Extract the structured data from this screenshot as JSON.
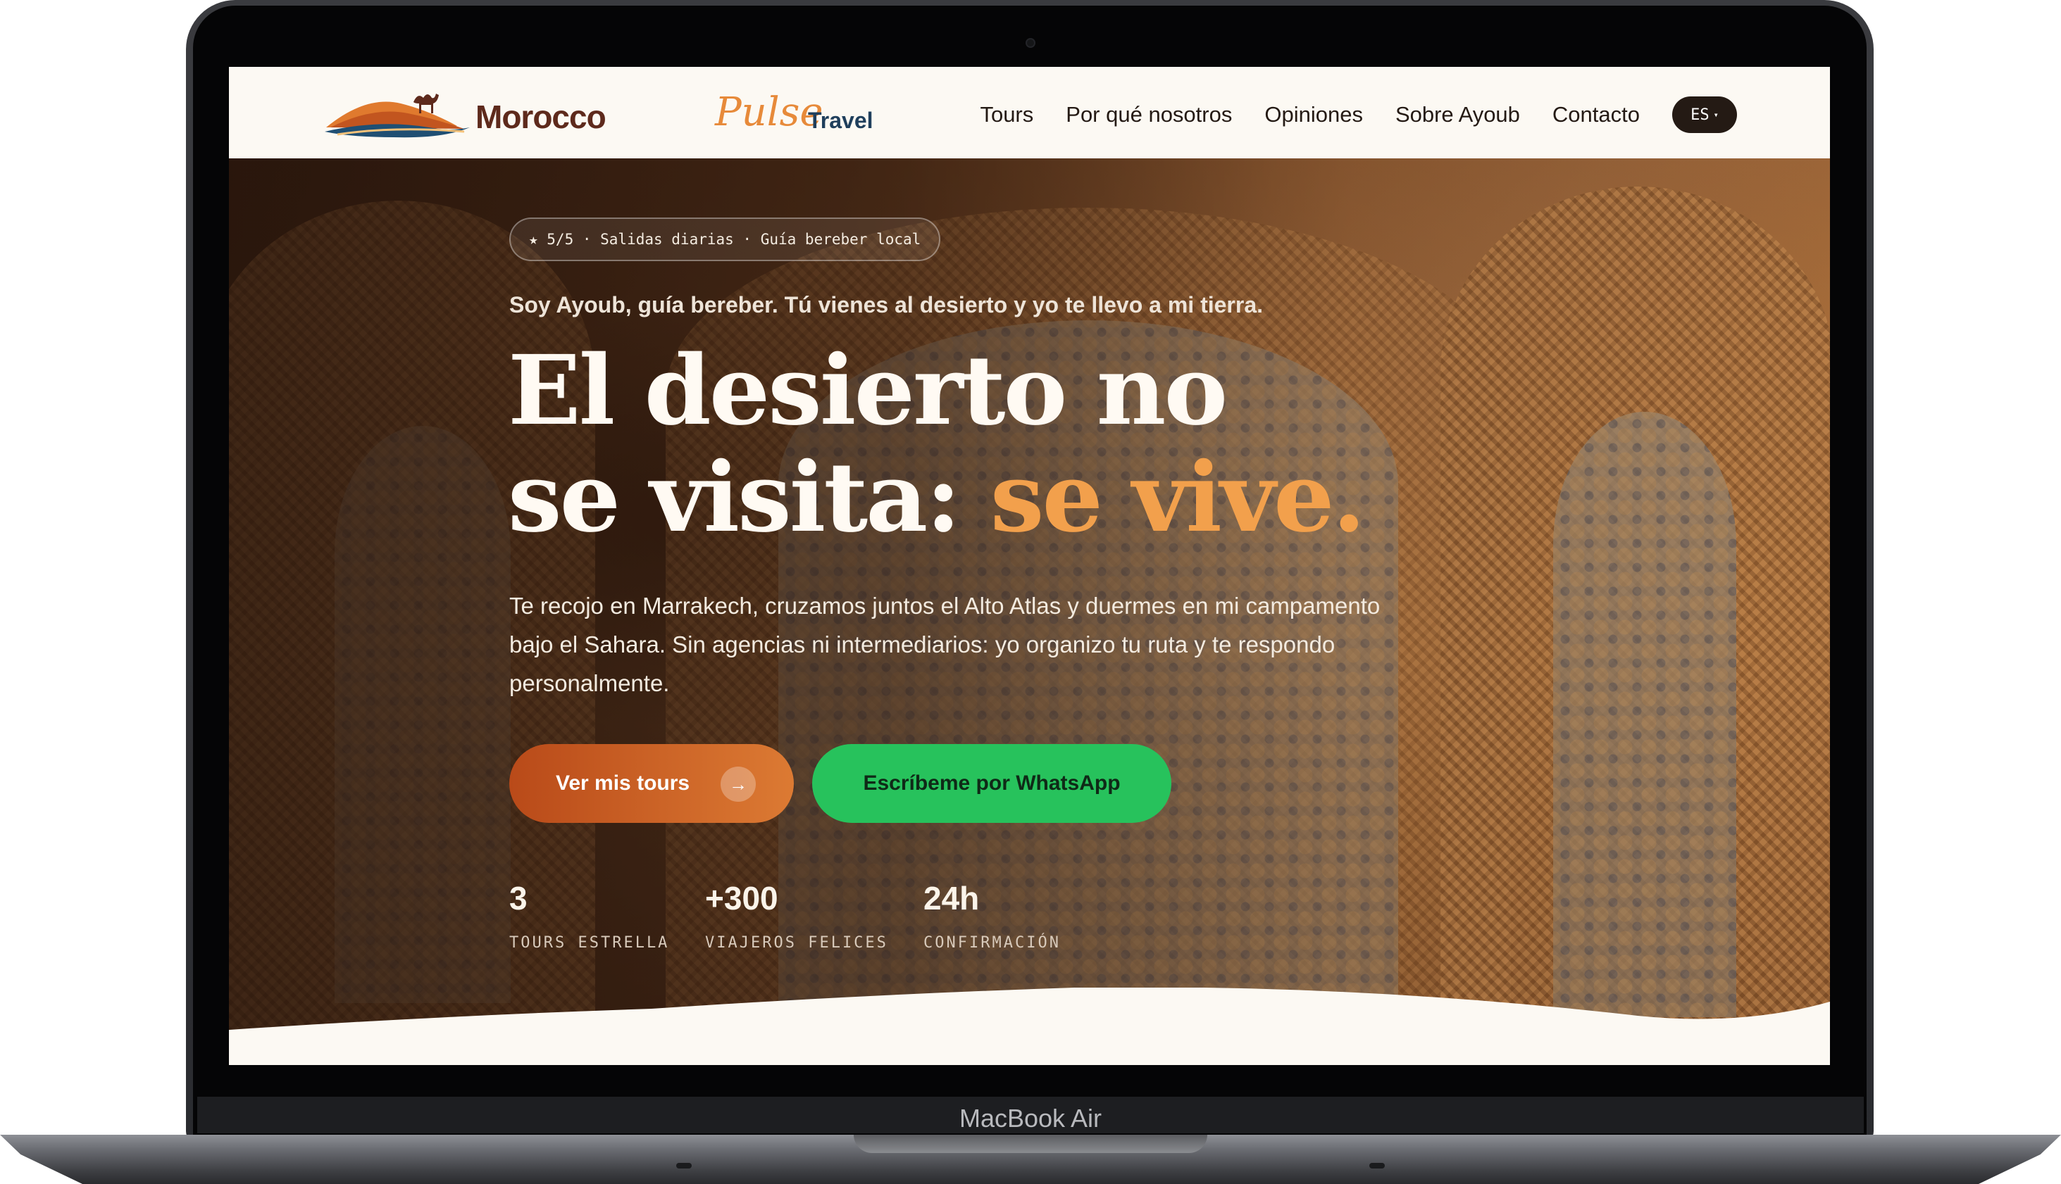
{
  "device": {
    "label": "MacBook Air"
  },
  "nav": {
    "brand": {
      "word1": "Morocco",
      "word2": "Pulse",
      "word3": "Travel"
    },
    "items": [
      {
        "label": "Tours"
      },
      {
        "label": "Por qué nosotros"
      },
      {
        "label": "Opiniones"
      },
      {
        "label": "Sobre Ayoub"
      },
      {
        "label": "Contacto"
      }
    ],
    "language": "ES",
    "language_caret": "▾"
  },
  "hero": {
    "badge": "★ 5/5 · Salidas diarias · Guía bereber local",
    "kicker": "Soy Ayoub, guía bereber. Tú vienes al desierto y yo te llevo a mi tierra.",
    "title_line1": "El desierto no",
    "title_line2_a": "se visita: ",
    "title_line2_b": "se vive.",
    "lead": "Te recojo en Marrakech, cruzamos juntos el Alto Atlas y duermes en mi campamento bajo el Sahara. Sin agencias ni intermediarios: yo organizo tu ruta y te respondo personalmente.",
    "cta_primary": "Ver mis tours",
    "cta_primary_icon": "→",
    "cta_secondary": "Escríbeme por WhatsApp",
    "stats": [
      {
        "value": "3",
        "label": "TOURS ESTRELLA"
      },
      {
        "value": "+300",
        "label": "VIAJEROS FELICES"
      },
      {
        "value": "24h",
        "label": "CONFIRMACIÓN"
      }
    ]
  },
  "colors": {
    "accent": "#f2a04c",
    "primary_button": "#c9561f",
    "whatsapp": "#27c25c",
    "nav_bg": "#fcf9f3",
    "text_dark": "#241a14"
  }
}
